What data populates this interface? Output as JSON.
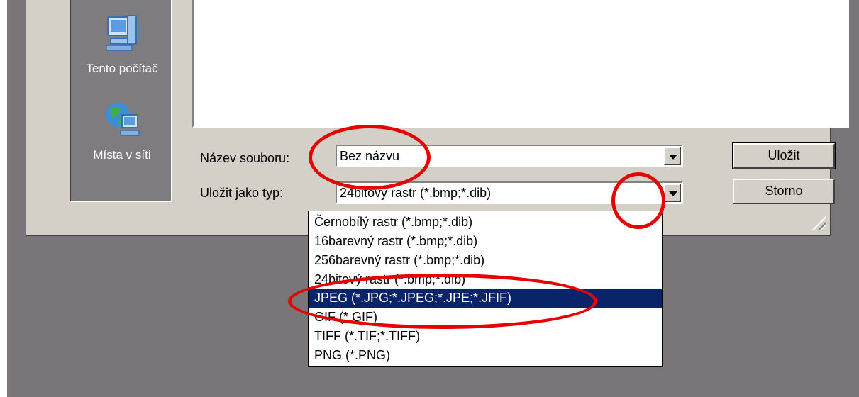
{
  "places": [
    {
      "label": "Tento počítač",
      "icon": "my-computer-icon"
    },
    {
      "label": "Místa v síti",
      "icon": "network-places-icon"
    }
  ],
  "form": {
    "filename_label": "Název souboru:",
    "filename_value": "Bez názvu",
    "type_label": "Uložit jako typ:",
    "type_value": "24bitový rastr (*.bmp;*.dib)"
  },
  "buttons": {
    "save": "Uložit",
    "cancel": "Storno"
  },
  "type_options": [
    "Černobílý rastr (*.bmp;*.dib)",
    "16barevný rastr (*.bmp;*.dib)",
    "256barevný rastr (*.bmp;*.dib)",
    "24bitový rastr (*.bmp;*.dib)",
    "JPEG (*.JPG;*.JPEG;*.JPE;*.JFIF)",
    "GIF (*.GIF)",
    "TIFF (*.TIF;*.TIFF)",
    "PNG (*.PNG)"
  ],
  "selected_option": "JPEG (*.JPG;*.JPEG;*.JPE;*.JFIF)",
  "colors": {
    "selection": "#0a246a",
    "annotation": "#e60000",
    "dialog": "#d4d0c8",
    "desktop": "#7a7579"
  }
}
